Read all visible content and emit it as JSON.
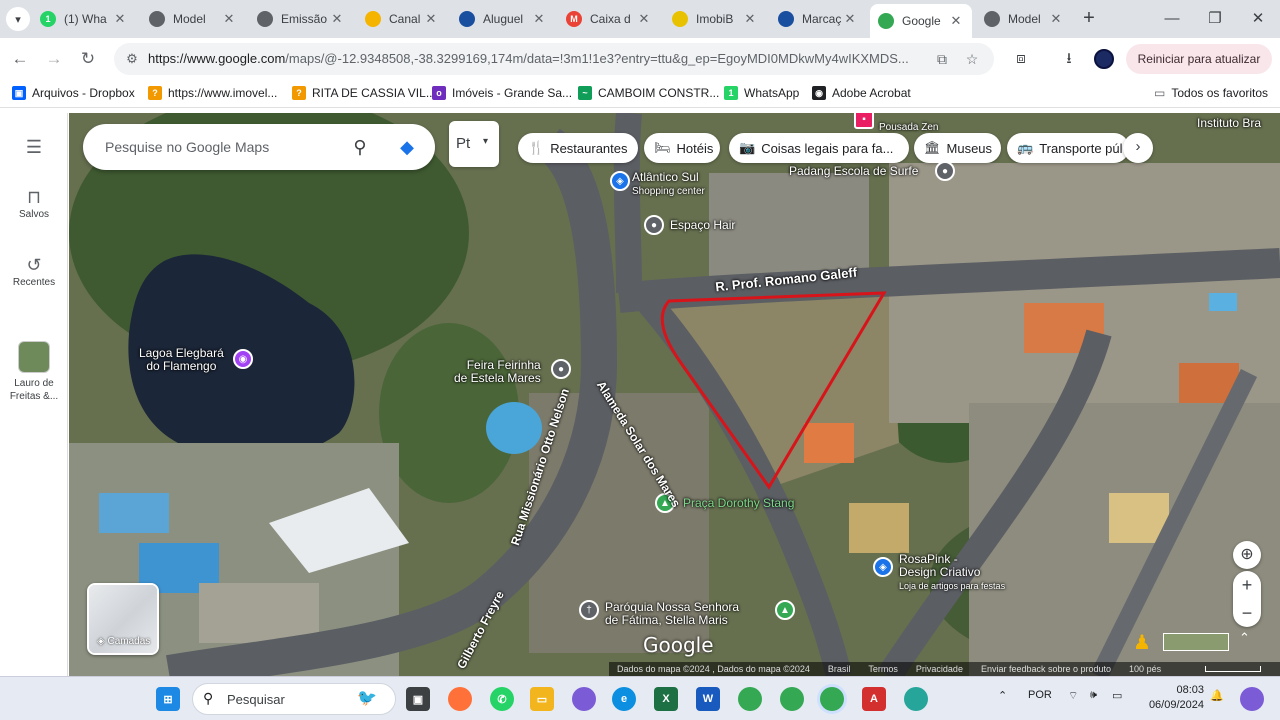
{
  "browser": {
    "tabs": [
      {
        "title": "(1) Wha",
        "favicon_color": "#25d366",
        "favicon_label": "1"
      },
      {
        "title": "Model",
        "favicon_color": "#5f6368",
        "favicon_label": ""
      },
      {
        "title": "Emissão",
        "favicon_color": "#5f6368",
        "favicon_label": ""
      },
      {
        "title": "Canal P",
        "favicon_color": "#f4b400",
        "favicon_label": ""
      },
      {
        "title": "Aluguel",
        "favicon_color": "#1a4fa0",
        "favicon_label": ""
      },
      {
        "title": "Caixa d",
        "favicon_color": "#ea4335",
        "favicon_label": "M"
      },
      {
        "title": "ImobiB",
        "favicon_color": "#e8c200",
        "favicon_label": ""
      },
      {
        "title": "Marcaç",
        "favicon_color": "#1a4fa0",
        "favicon_label": ""
      },
      {
        "title": "Google",
        "favicon_color": "#34a853",
        "favicon_label": ""
      },
      {
        "title": "Model",
        "favicon_color": "#5f6368",
        "favicon_label": ""
      }
    ],
    "active_tab_index": 8,
    "window_controls": {
      "minimize": "—",
      "restore": "❐",
      "close": "✕"
    },
    "url": {
      "host": "https://www.google.com",
      "path": "/maps/@-12.9348508,-38.3299169,174m/data=!3m1!1e3?entry=ttu&g_ep=EgoyMDI0MDkwMy4wIKXMDS..."
    },
    "update_button": "Reiniciar para atualizar"
  },
  "bookmarks": {
    "items": [
      {
        "label": "Arquivos - Dropbox",
        "icon_color": "#0061fe",
        "icon_label": "▣"
      },
      {
        "label": "https://www.imovel...",
        "icon_color": "#f29900",
        "icon_label": "?"
      },
      {
        "label": "RITA DE CASSIA VIL...",
        "icon_color": "#f29900",
        "icon_label": "?"
      },
      {
        "label": "Imóveis - Grande Sa...",
        "icon_color": "#6f2dbd",
        "icon_label": "o"
      },
      {
        "label": "CAMBOIM CONSTR...",
        "icon_color": "#0f9d58",
        "icon_label": "~"
      },
      {
        "label": "WhatsApp",
        "icon_color": "#25d366",
        "icon_label": "1"
      },
      {
        "label": "Adobe Acrobat",
        "icon_color": "#202124",
        "icon_label": "◉"
      }
    ],
    "all_favorites": "Todos os favoritos"
  },
  "maps": {
    "rail": [
      {
        "label": "Salvos",
        "icon": "bookmark-icon"
      },
      {
        "label": "Recentes",
        "icon": "history-icon"
      },
      {
        "label": "Lauro de Freitas &...",
        "icon": "place-thumbnail"
      }
    ],
    "search_placeholder": "Pesquise no Google Maps",
    "lang_label": "Pt",
    "chips": [
      {
        "label": "Restaurantes",
        "icon": "🍴"
      },
      {
        "label": "Hotéis",
        "icon": "🛏"
      },
      {
        "label": "Coisas legais para fa...",
        "icon": "📷"
      },
      {
        "label": "Museus",
        "icon": "🏛"
      },
      {
        "label": "Transporte púl",
        "icon": "🚌"
      }
    ],
    "labels": {
      "street1": "R. Prof. Romano Galeff",
      "street2": "Alameda Solar dos Mares",
      "street3": "Rua Missionário Otto Nelson",
      "street4": "Gilberto Freyre",
      "lagoa": "Lagoa Elegbará do Flamengo",
      "lagoa_line1": "Lagoa Elegbará",
      "lagoa_line2": "do Flamengo",
      "feira_line1": "Feira Feirinha",
      "feira_line2": "de Estela Mares",
      "atlantico_line1": "Atlântico Sul",
      "atlantico_line2": "Shopping center",
      "espaco": "Espaço Hair",
      "padang": "Padang Escola de Surfe",
      "praca": "Praça Dorothy Stang",
      "rosapink_line1": "RosaPink -",
      "rosapink_line2": "Design Criativo",
      "rosapink_line3": "Loja de artigos para festas",
      "paroquia_line1": "Paróquia Nossa Senhora",
      "paroquia_line2": "de Fátima, Stella Maris",
      "pousada": "Pousada Zen",
      "instituto": "Instituto Bra"
    },
    "layers_label": "Camadas",
    "google_logo": "Google",
    "attribution": [
      "Dados do mapa ©2024 , Dados do mapa ©2024",
      "Brasil",
      "Termos",
      "Privacidade",
      "Enviar feedback sobre o produto",
      "100 pés"
    ]
  },
  "taskbar": {
    "search_label": "Pesquisar",
    "lang": "POR",
    "time": "08:03",
    "date": "06/09/2024"
  }
}
